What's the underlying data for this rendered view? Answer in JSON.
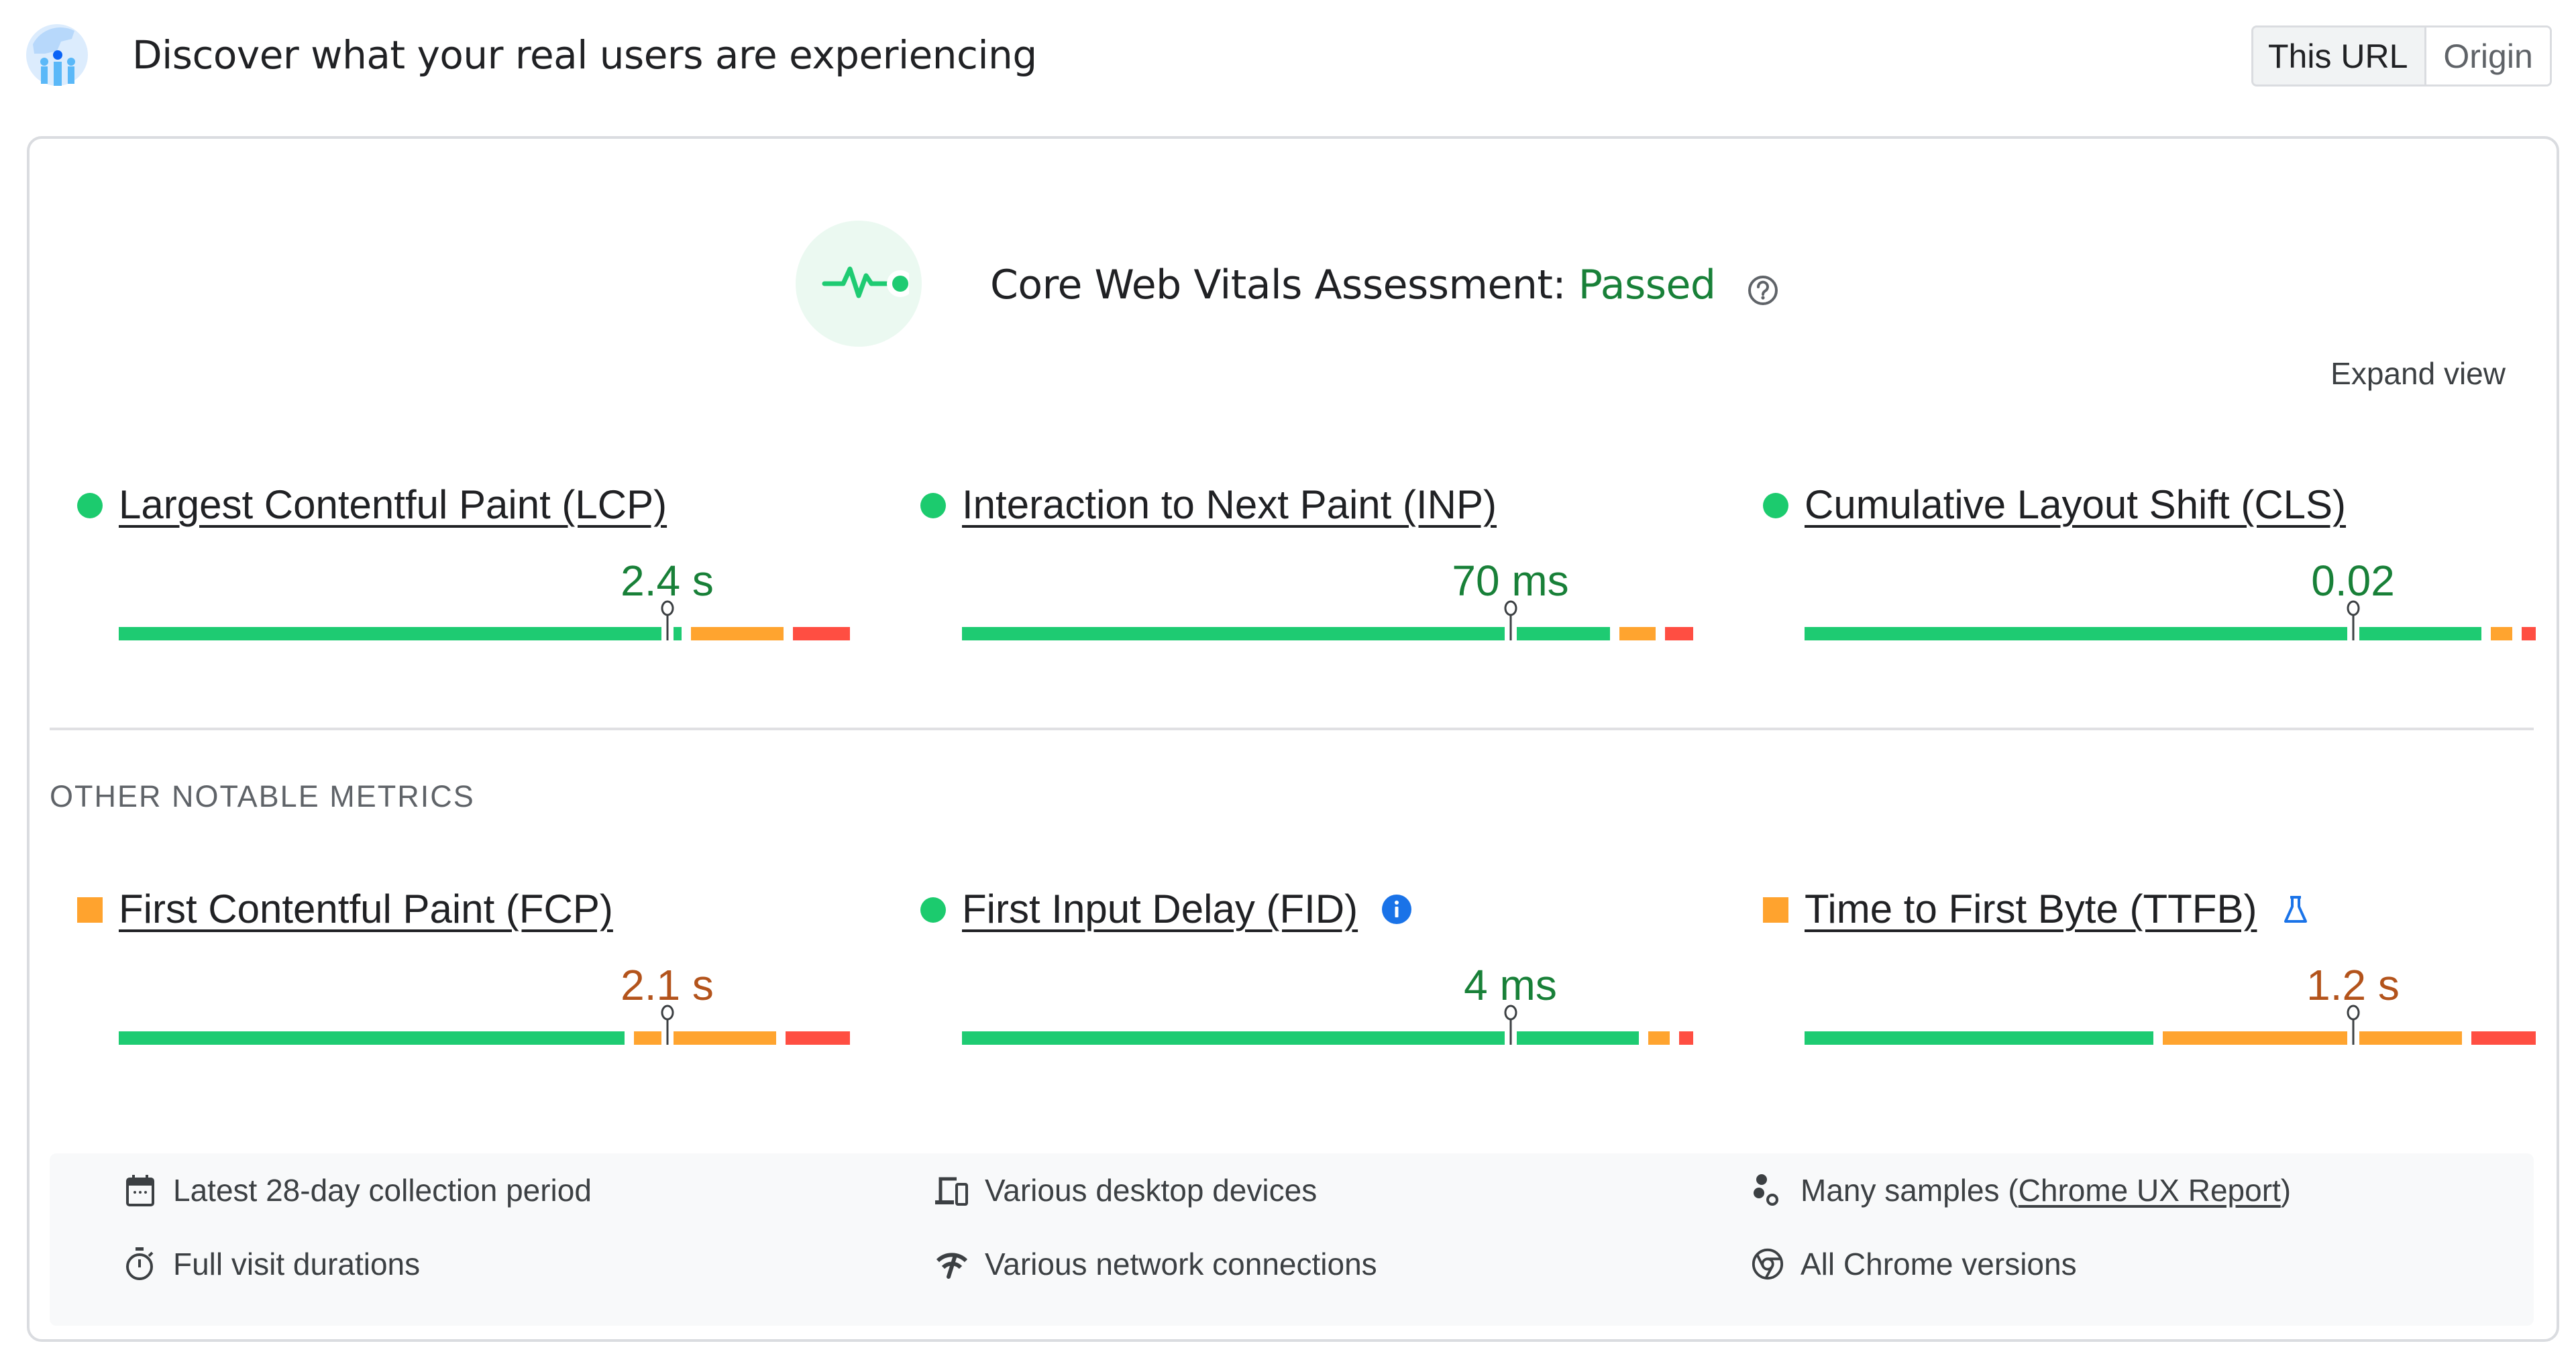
{
  "header": {
    "title": "Discover what your real users are experiencing",
    "logo_icon": "crux-users-icon",
    "scope_toggle": {
      "options": [
        "This URL",
        "Origin"
      ],
      "selected": "This URL"
    }
  },
  "assessment": {
    "icon": "pulse-icon",
    "label": "Core Web Vitals Assessment:",
    "status": "Passed",
    "status_color": "#188038",
    "help_icon": "help-circle-icon",
    "expand_label": "Expand view"
  },
  "core_metrics": [
    {
      "name": "Largest Contentful Paint (LCP)",
      "rating": "good",
      "indicator": "circle",
      "value": "2.4 s",
      "distribution_pct": {
        "good": 79,
        "needs_improvement": 13,
        "poor": 8
      },
      "percentile_position": 75
    },
    {
      "name": "Interaction to Next Paint (INP)",
      "rating": "good",
      "indicator": "circle",
      "value": "70 ms",
      "distribution_pct": {
        "good": 91,
        "needs_improvement": 5,
        "poor": 4
      },
      "percentile_position": 75
    },
    {
      "name": "Cumulative Layout Shift (CLS)",
      "rating": "good",
      "indicator": "circle",
      "value": "0.02",
      "distribution_pct": {
        "good": 95,
        "needs_improvement": 3,
        "poor": 2
      },
      "percentile_position": 75
    }
  ],
  "other_section_label": "OTHER NOTABLE METRICS",
  "other_metrics": [
    {
      "name": "First Contentful Paint (FCP)",
      "rating": "needs_improvement",
      "indicator": "square",
      "value": "2.1 s",
      "distribution_pct": {
        "good": 71,
        "needs_improvement": 20,
        "poor": 9
      },
      "percentile_position": 75
    },
    {
      "name": "First Input Delay (FID)",
      "rating": "good",
      "indicator": "circle",
      "value": "4 ms",
      "badge_icon": "info-icon",
      "distribution_pct": {
        "good": 95,
        "needs_improvement": 3,
        "poor": 2
      },
      "percentile_position": 75
    },
    {
      "name": "Time to First Byte (TTFB)",
      "rating": "needs_improvement",
      "indicator": "square",
      "value": "1.2 s",
      "badge_icon": "experimental-flask-icon",
      "distribution_pct": {
        "good": 49,
        "needs_improvement": 42,
        "poor": 9
      },
      "percentile_position": 75
    }
  ],
  "info": [
    {
      "icon": "calendar-icon",
      "text": "Latest 28-day collection period"
    },
    {
      "icon": "devices-icon",
      "text": "Various desktop devices"
    },
    {
      "icon": "samples-icon",
      "text_before": "Many samples (",
      "link": "Chrome UX Report",
      "text_after": ")"
    },
    {
      "icon": "timer-icon",
      "text": "Full visit durations"
    },
    {
      "icon": "network-icon",
      "text": "Various network connections"
    },
    {
      "icon": "chrome-icon",
      "text": "All Chrome versions"
    }
  ],
  "colors": {
    "good": "#1ecb72",
    "needs_improvement": "#ffa42f",
    "poor": "#ff4e42",
    "good_text": "#188038",
    "ni_text": "#b3531b",
    "link_blue": "#1a73e8"
  }
}
